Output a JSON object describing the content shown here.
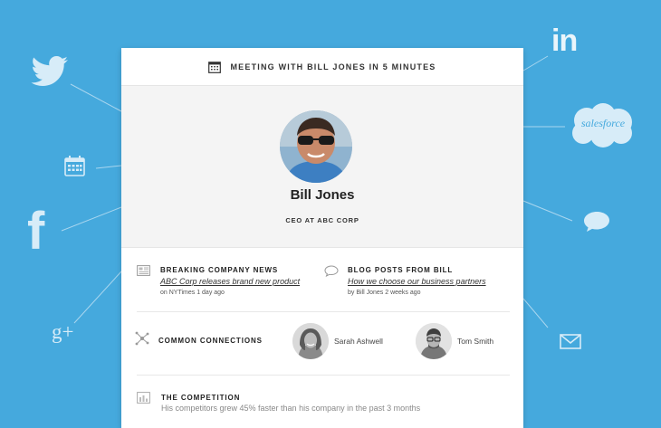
{
  "card": {
    "header_title": "MEETING WITH BILL JONES IN 5 MINUTES"
  },
  "profile": {
    "name": "Bill Jones",
    "title": "CEO AT ABC CORP"
  },
  "news": {
    "label": "BREAKING COMPANY NEWS",
    "link": "ABC Corp releases brand new product",
    "meta": "on NYTimes 1 day ago"
  },
  "blog": {
    "label": "BLOG POSTS FROM BILL",
    "link": "How we choose our business partners",
    "meta": "by Bill Jones 2 weeks ago"
  },
  "connections": {
    "label": "COMMON CONNECTIONS",
    "people": [
      {
        "name": "Sarah Ashwell"
      },
      {
        "name": "Tom Smith"
      }
    ]
  },
  "competition": {
    "label": "THE COMPETITION",
    "text": "His competitors grew 45% faster than his company in the past 3 months"
  },
  "integrations": {
    "linkedin": "in",
    "salesforce": "salesforce",
    "googleplus": "g+",
    "facebook": "f"
  },
  "colors": {
    "background": "#45a9dd",
    "icon": "#d7ecf8",
    "card": "#ffffff"
  }
}
